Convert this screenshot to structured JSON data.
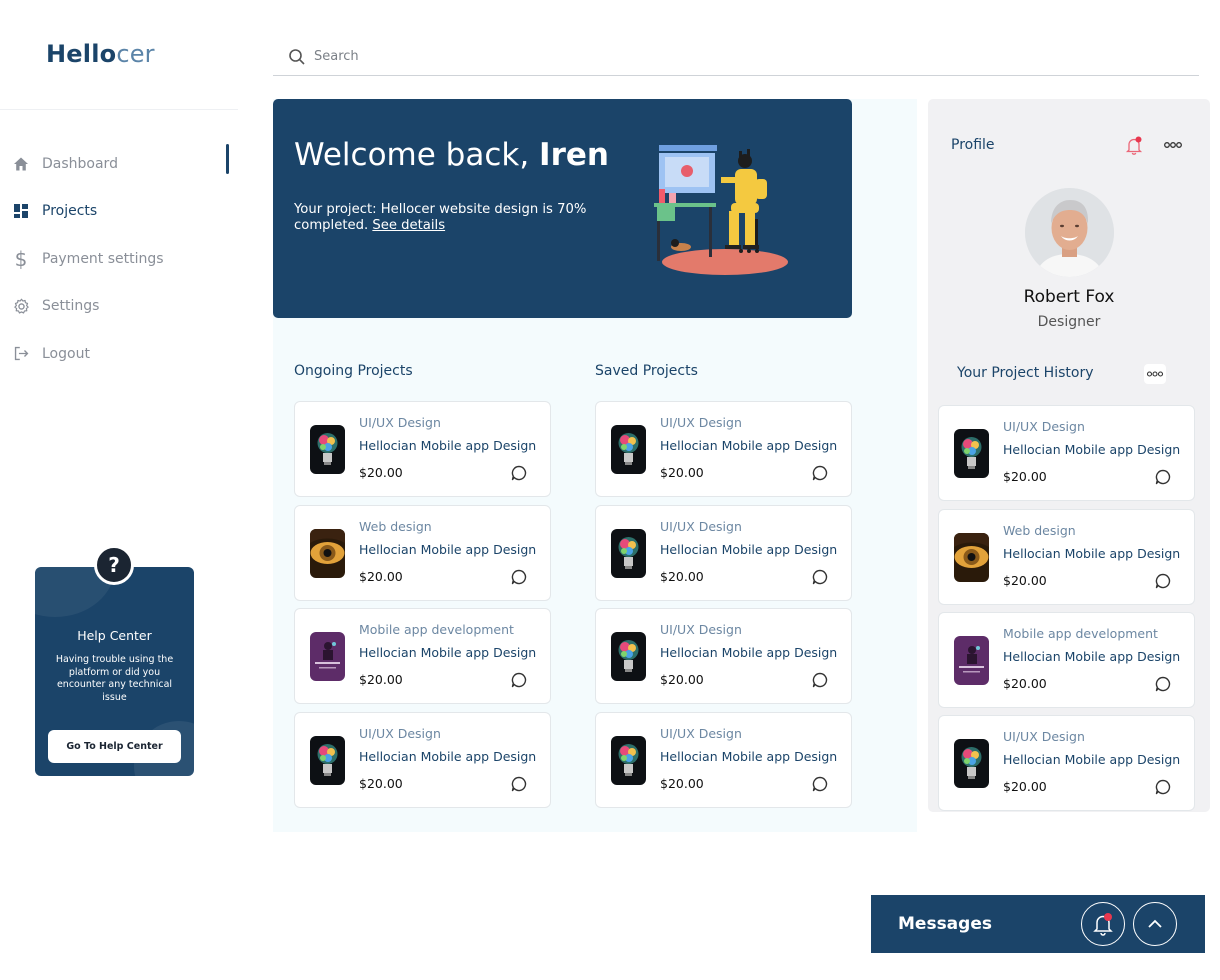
{
  "brand": {
    "part1": "Hello",
    "part2": "cer"
  },
  "search": {
    "placeholder": "Search"
  },
  "sidebar": {
    "items": [
      {
        "label": "Dashboard",
        "icon": "home-icon"
      },
      {
        "label": "Projects",
        "icon": "grid-icon",
        "active": true
      },
      {
        "label": "Payment settings",
        "icon": "dollar-icon"
      },
      {
        "label": "Settings",
        "icon": "gear-icon"
      },
      {
        "label": "Logout",
        "icon": "logout-icon"
      }
    ]
  },
  "help_center": {
    "badge": "?",
    "title": "Help Center",
    "text": "Having trouble using the platform or did you encounter any technical issue",
    "button": "Go To Help Center"
  },
  "hero": {
    "greeting": "Welcome back, ",
    "user": "Iren",
    "text": "Your project: Hellocer website design is 70% completed. ",
    "link": "See details"
  },
  "ongoing": {
    "title": "Ongoing Projects",
    "items": [
      {
        "category": "UI/UX Design",
        "name": "Hellocian Mobile app Design",
        "price": "$20.00",
        "thumb": "bulb"
      },
      {
        "category": "Web design",
        "name": "Hellocian Mobile app Design",
        "price": "$20.00",
        "thumb": "eye"
      },
      {
        "category": "Mobile app development",
        "name": "Hellocian Mobile app Design",
        "price": "$20.00",
        "thumb": "purple"
      },
      {
        "category": "UI/UX Design",
        "name": "Hellocian Mobile app Design",
        "price": "$20.00",
        "thumb": "bulb"
      }
    ]
  },
  "saved": {
    "title": "Saved Projects",
    "items": [
      {
        "category": "UI/UX Design",
        "name": "Hellocian Mobile app Design",
        "price": "$20.00",
        "thumb": "bulb"
      },
      {
        "category": "UI/UX Design",
        "name": "Hellocian Mobile app Design",
        "price": "$20.00",
        "thumb": "bulb"
      },
      {
        "category": "UI/UX Design",
        "name": "Hellocian Mobile app Design",
        "price": "$20.00",
        "thumb": "bulb"
      },
      {
        "category": "UI/UX Design",
        "name": "Hellocian Mobile app Design",
        "price": "$20.00",
        "thumb": "bulb"
      }
    ]
  },
  "profile": {
    "title": "Profile",
    "name": "Robert Fox",
    "role": "Designer",
    "history_title": "Your Project History",
    "history": [
      {
        "category": "UI/UX Design",
        "name": "Hellocian Mobile app Design",
        "price": "$20.00",
        "thumb": "bulb"
      },
      {
        "category": "Web design",
        "name": "Hellocian Mobile app Design",
        "price": "$20.00",
        "thumb": "eye"
      },
      {
        "category": "Mobile app development",
        "name": "Hellocian Mobile app Design",
        "price": "$20.00",
        "thumb": "purple"
      },
      {
        "category": "UI/UX Design",
        "name": "Hellocian Mobile app Design",
        "price": "$20.00",
        "thumb": "bulb"
      }
    ]
  },
  "messages": {
    "label": "Messages"
  },
  "colors": {
    "primary": "#1b4469",
    "accent": "#5b84a8",
    "alert": "#e8384f",
    "panel": "#f4fbfd"
  }
}
